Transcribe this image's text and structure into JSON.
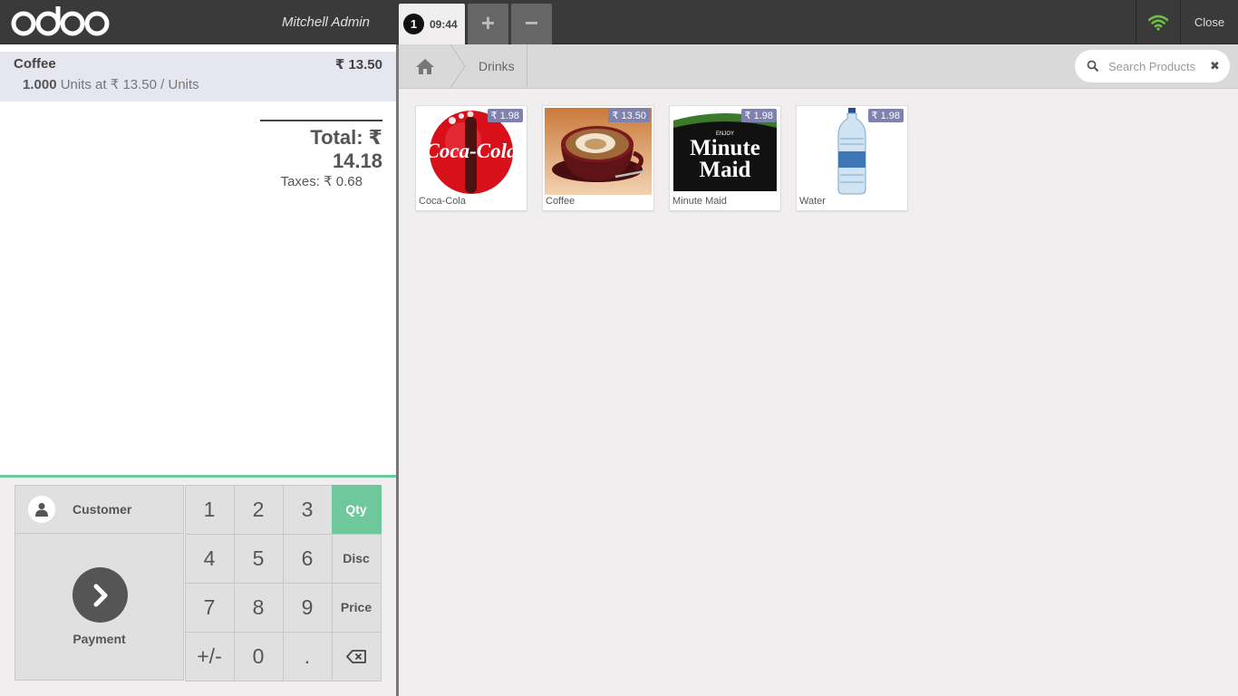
{
  "header": {
    "logo_text": "odoo",
    "username": "Mitchell Admin",
    "order_number": "1",
    "order_time": "09:44",
    "add_order": "+",
    "remove_order": "−",
    "close": "Close",
    "wifi_color": "#6ac046"
  },
  "order": {
    "line": {
      "product": "Coffee",
      "price": "₹ 13.50",
      "qty": "1.000",
      "detail": " Units at ₹ 13.50 / Units"
    },
    "total": "Total: ₹ 14.18",
    "taxes": "Taxes: ₹ 0.68"
  },
  "actions": {
    "customer": "Customer",
    "payment": "Payment"
  },
  "numpad": {
    "keys": [
      "1",
      "2",
      "3",
      "Qty",
      "4",
      "5",
      "6",
      "Disc",
      "7",
      "8",
      "9",
      "Price",
      "+/-",
      "0",
      ".",
      "⌫"
    ],
    "active_mode": "Qty",
    "accent": "#6ec89b"
  },
  "breadcrumb": {
    "home_icon": "home-icon",
    "category": "Drinks"
  },
  "search": {
    "placeholder": "Search Products",
    "value": ""
  },
  "products": [
    {
      "name": "Coca-Cola",
      "price": "₹ 1.98"
    },
    {
      "name": "Coffee",
      "price": "₹ 13.50"
    },
    {
      "name": "Minute Maid",
      "price": "₹ 1.98"
    },
    {
      "name": "Water",
      "price": "₹ 1.98"
    }
  ],
  "product_images": {
    "minute_maid_top": "ENJOY",
    "minute_maid_line1": "Minute",
    "minute_maid_line2": "Maid",
    "coca_cola": "Coca-Cola"
  }
}
